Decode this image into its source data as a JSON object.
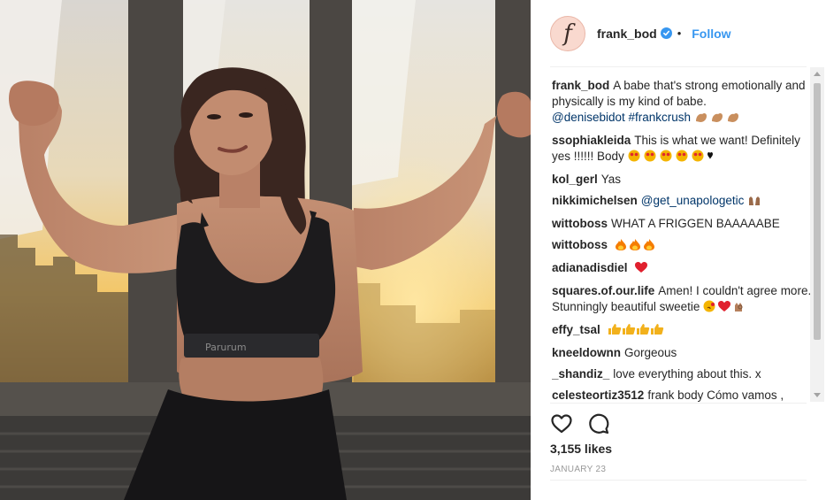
{
  "post": {
    "author": "frank_bod",
    "avatar_letter": "f",
    "separator": "•",
    "follow_label": "Follow",
    "likes": "3,155 likes",
    "date": "JANUARY 23",
    "photo_text": "Parurum"
  },
  "comments": [
    {
      "user": "frank_bod",
      "text": "A babe that's strong emotionally and physically is my kind of babe.",
      "links": "@denisebidot #frankcrush",
      "emoji": "flexed-biceps x3"
    },
    {
      "user": "ssophiakleida",
      "text": "This is what we want! Definitely yes !!!!!! Body",
      "emoji": "heart-eyes x5, black-heart"
    },
    {
      "user": "kol_gerl",
      "text": "Yas"
    },
    {
      "user": "nikkimichelsen",
      "links": "@get_unapologetic",
      "emoji": "raising-hands"
    },
    {
      "user": "wittoboss",
      "text": "WHAT A FRIGGEN BAAAAABE"
    },
    {
      "user": "wittoboss",
      "emoji": "fire x3"
    },
    {
      "user": "adianadisdiel",
      "emoji": "red-heart"
    },
    {
      "user": "squares.of.our.life",
      "text": "Amen! I couldn't agree more. Stunningly beautiful sweetie",
      "emoji": "kiss-face, red-heart, ok-hand"
    },
    {
      "user": "effy_tsal",
      "emoji": "thumbs-up x4"
    },
    {
      "user": "kneeldownn",
      "text": "Gorgeous"
    },
    {
      "user": "_shandiz_",
      "text": "love everything about this. x"
    },
    {
      "user": "celesteortiz3512",
      "text": "frank body Cómo vamos , bailar ENTRE LA ESPADA Y LA PARED de"
    }
  ],
  "icons": {
    "verified": "verified-badge-icon",
    "like": "heart-outline-icon",
    "comment": "comment-bubble-icon"
  },
  "colors": {
    "link": "#003569",
    "follow": "#3897f0",
    "verified": "#3897f0",
    "date": "#999999"
  }
}
